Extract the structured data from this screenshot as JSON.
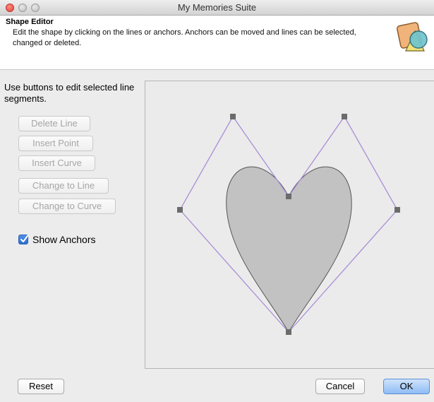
{
  "window": {
    "title": "My Memories Suite"
  },
  "header": {
    "title": "Shape Editor",
    "description": "Edit the shape by clicking on the lines or anchors. Anchors can be moved and lines can be selected, changed or deleted."
  },
  "sidebar": {
    "instructions": "Use buttons to edit selected line segments.",
    "buttons": [
      {
        "label": "Delete Line",
        "enabled": false
      },
      {
        "label": "Insert Point",
        "enabled": false
      },
      {
        "label": "Insert Curve",
        "enabled": false
      },
      {
        "label": "Change to Line",
        "enabled": false
      },
      {
        "label": "Change to Curve",
        "enabled": false
      }
    ],
    "show_anchors": {
      "label": "Show Anchors",
      "checked": true
    }
  },
  "footer": {
    "reset_label": "Reset",
    "cancel_label": "Cancel",
    "ok_label": "OK"
  },
  "colors": {
    "guide_line": "#a98ed8",
    "shape_fill": "#c2c2c2",
    "anchor": "#6b6b6b",
    "accent": "#5c8fd6"
  }
}
